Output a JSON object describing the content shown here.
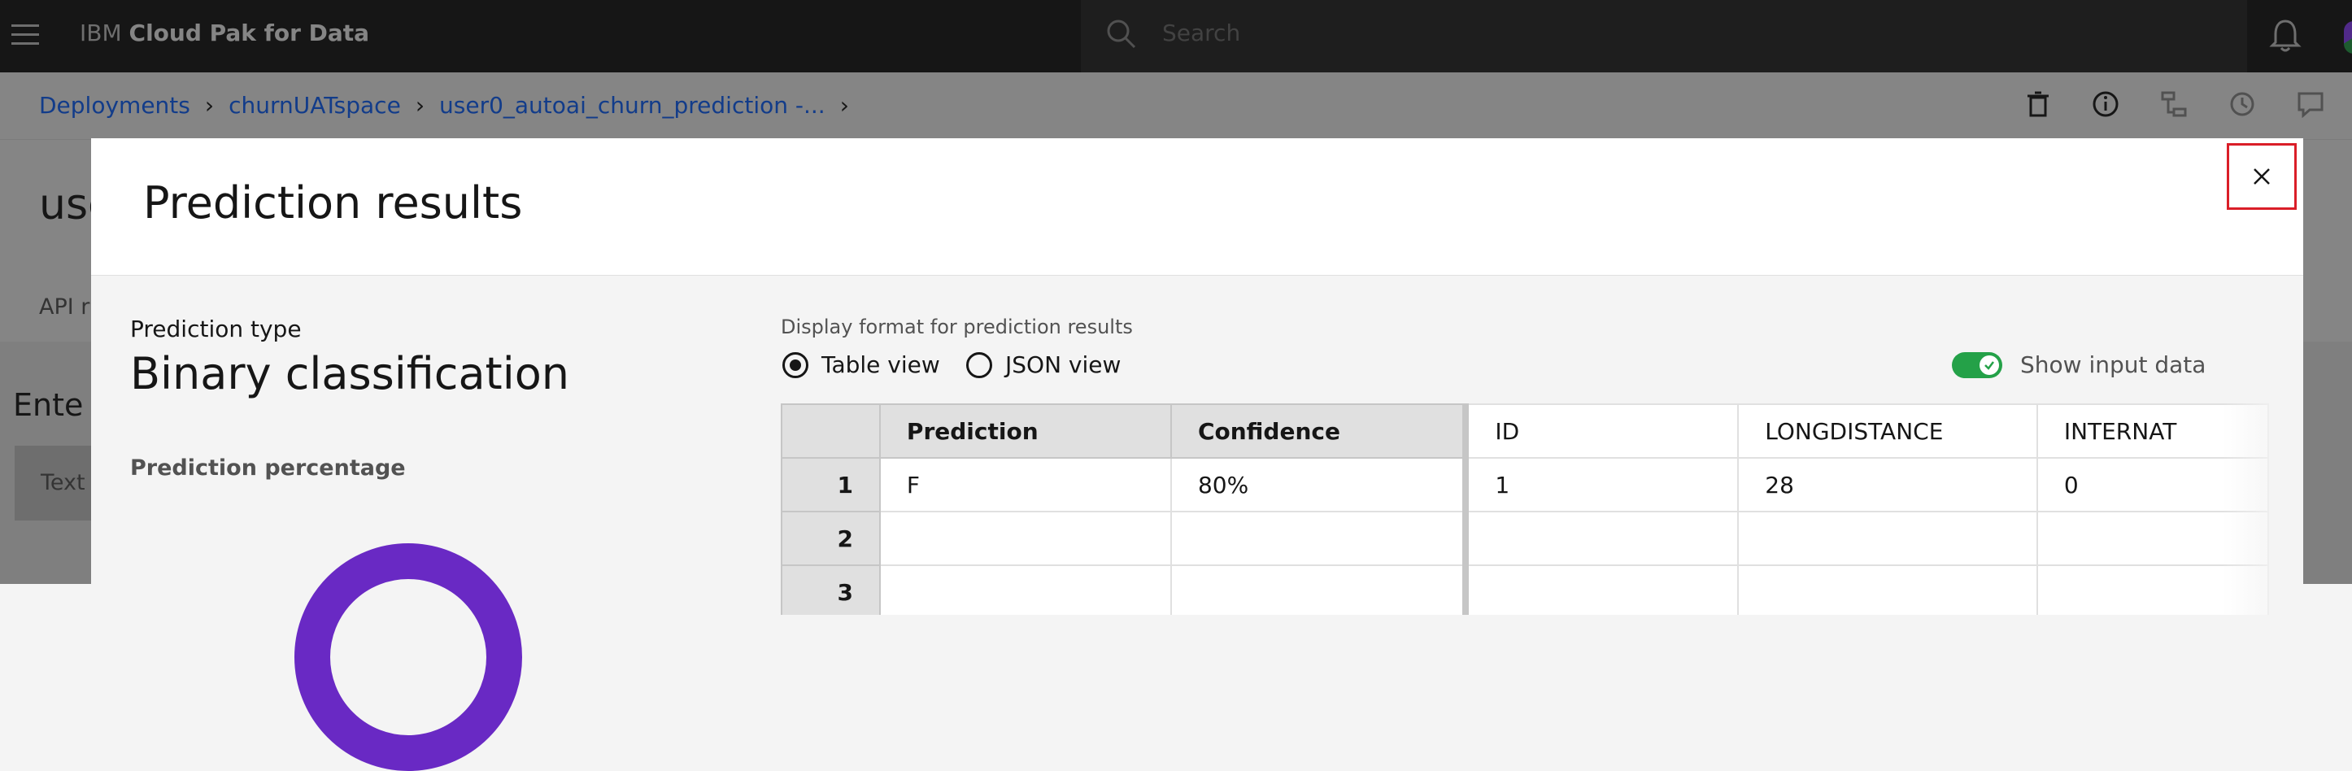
{
  "header": {
    "brand_prefix": "IBM",
    "brand_name": "Cloud Pak for Data",
    "search_placeholder": "Search"
  },
  "breadcrumb": {
    "items": [
      "Deployments",
      "churnUATspace",
      "user0_autoai_churn_prediction -..."
    ]
  },
  "background_page": {
    "title": "use",
    "tab": "API r",
    "section_title": "Ente",
    "text_tab": "Text"
  },
  "modal": {
    "title": "Prediction results",
    "prediction_type_label": "Prediction type",
    "prediction_type_value": "Binary classification",
    "prediction_percentage_label": "Prediction percentage",
    "display_format_label": "Display format for prediction results",
    "view_options": [
      {
        "label": "Table view",
        "selected": true
      },
      {
        "label": "JSON view",
        "selected": false
      }
    ],
    "show_input_label": "Show input data",
    "show_input_enabled": true,
    "table": {
      "columns": [
        "",
        "Prediction",
        "Confidence",
        "ID",
        "LONGDISTANCE",
        "INTERNAT"
      ],
      "rows": [
        [
          "1",
          "F",
          "80%",
          "1",
          "28",
          "0"
        ],
        [
          "2",
          "",
          "",
          "",
          "",
          ""
        ],
        [
          "3",
          "",
          "",
          "",
          "",
          ""
        ]
      ]
    }
  },
  "colors": {
    "header_bg": "#161616",
    "link": "#0f62fe",
    "toggle_on": "#24a148",
    "donut": "#6929c4",
    "close_highlight": "#da1e28"
  }
}
